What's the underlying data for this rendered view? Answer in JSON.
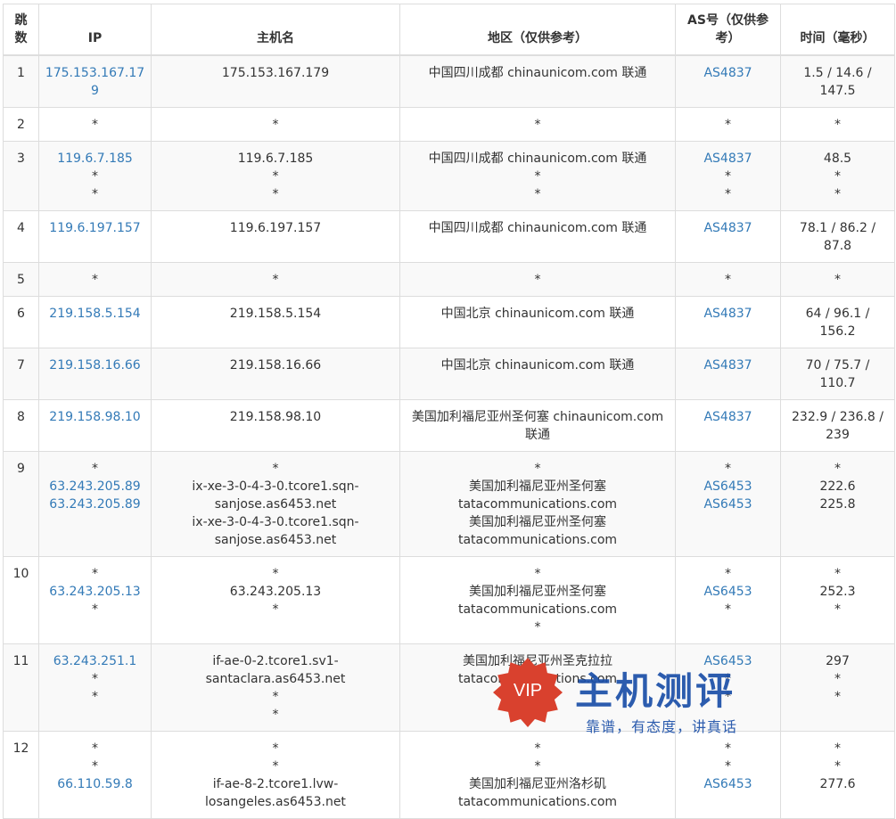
{
  "table": {
    "headers": {
      "hop": "跳数",
      "ip": "IP",
      "host": "主机名",
      "region": "地区（仅供参考）",
      "as": "AS号（仅供参考）",
      "time": "时间（毫秒）"
    },
    "rows": [
      {
        "hop": "1",
        "ip": [
          "175.153.167.179"
        ],
        "host": [
          "175.153.167.179"
        ],
        "region": [
          "中国四川成都 chinaunicom.com 联通"
        ],
        "as": [
          "AS4837"
        ],
        "time": [
          "1.5 / 14.6 / 147.5"
        ]
      },
      {
        "hop": "2",
        "ip": [
          "*"
        ],
        "host": [
          "*"
        ],
        "region": [
          "*"
        ],
        "as": [
          "*"
        ],
        "time": [
          "*"
        ]
      },
      {
        "hop": "3",
        "ip": [
          "119.6.7.185",
          "*",
          "*"
        ],
        "host": [
          "119.6.7.185",
          "*",
          "*"
        ],
        "region": [
          "中国四川成都 chinaunicom.com 联通",
          "*",
          "*"
        ],
        "as": [
          "AS4837",
          "*",
          "*"
        ],
        "time": [
          "48.5",
          "*",
          "*"
        ]
      },
      {
        "hop": "4",
        "ip": [
          "119.6.197.157"
        ],
        "host": [
          "119.6.197.157"
        ],
        "region": [
          "中国四川成都 chinaunicom.com 联通"
        ],
        "as": [
          "AS4837"
        ],
        "time": [
          "78.1 / 86.2 / 87.8"
        ]
      },
      {
        "hop": "5",
        "ip": [
          "*"
        ],
        "host": [
          "*"
        ],
        "region": [
          "*"
        ],
        "as": [
          "*"
        ],
        "time": [
          "*"
        ]
      },
      {
        "hop": "6",
        "ip": [
          "219.158.5.154"
        ],
        "host": [
          "219.158.5.154"
        ],
        "region": [
          "中国北京 chinaunicom.com 联通"
        ],
        "as": [
          "AS4837"
        ],
        "time": [
          "64 / 96.1 / 156.2"
        ]
      },
      {
        "hop": "7",
        "ip": [
          "219.158.16.66"
        ],
        "host": [
          "219.158.16.66"
        ],
        "region": [
          "中国北京 chinaunicom.com 联通"
        ],
        "as": [
          "AS4837"
        ],
        "time": [
          "70 / 75.7 / 110.7"
        ]
      },
      {
        "hop": "8",
        "ip": [
          "219.158.98.10"
        ],
        "host": [
          "219.158.98.10"
        ],
        "region": [
          "美国加利福尼亚州圣何塞 chinaunicom.com 联通"
        ],
        "as": [
          "AS4837"
        ],
        "time": [
          "232.9 / 236.8 / 239"
        ]
      },
      {
        "hop": "9",
        "ip": [
          "*",
          "63.243.205.89",
          "63.243.205.89"
        ],
        "host": [
          "*",
          "ix-xe-3-0-4-3-0.tcore1.sqn-sanjose.as6453.net",
          "ix-xe-3-0-4-3-0.tcore1.sqn-sanjose.as6453.net"
        ],
        "region": [
          "*",
          "美国加利福尼亚州圣何塞 tatacommunications.com",
          "美国加利福尼亚州圣何塞 tatacommunications.com"
        ],
        "as": [
          "*",
          "AS6453",
          "AS6453"
        ],
        "time": [
          "*",
          "222.6",
          "225.8"
        ]
      },
      {
        "hop": "10",
        "ip": [
          "*",
          "63.243.205.13",
          "*"
        ],
        "host": [
          "*",
          "63.243.205.13",
          "*"
        ],
        "region": [
          "*",
          "美国加利福尼亚州圣何塞 tatacommunications.com",
          "*"
        ],
        "as": [
          "*",
          "AS6453",
          "*"
        ],
        "time": [
          "*",
          "252.3",
          "*"
        ]
      },
      {
        "hop": "11",
        "ip": [
          "63.243.251.1",
          "*",
          "*"
        ],
        "host": [
          "if-ae-0-2.tcore1.sv1-santaclara.as6453.net",
          "*",
          "*"
        ],
        "region": [
          "美国加利福尼亚州圣克拉拉 tatacommunications.com",
          "*",
          "*"
        ],
        "as": [
          "AS6453",
          "*",
          "*"
        ],
        "time": [
          "297",
          "*",
          "*"
        ]
      },
      {
        "hop": "12",
        "ip": [
          "*",
          "*",
          "66.110.59.8"
        ],
        "host": [
          "*",
          "*",
          "if-ae-8-2.tcore1.lvw-losangeles.as6453.net"
        ],
        "region": [
          "*",
          "*",
          "美国加利福尼亚州洛杉矶 tatacommunications.com"
        ],
        "as": [
          "*",
          "*",
          "AS6453"
        ],
        "time": [
          "*",
          "*",
          "277.6"
        ]
      }
    ]
  },
  "watermark": {
    "badge": "VIP",
    "title": "主机测评",
    "subtitle": "靠谱，有态度，讲真话",
    "badge_color": "#d9412e",
    "title_color": "#1b4fa8"
  },
  "colors": {
    "link": "#337ab7",
    "border": "#dddddd",
    "stripe": "#f9f9f9"
  }
}
